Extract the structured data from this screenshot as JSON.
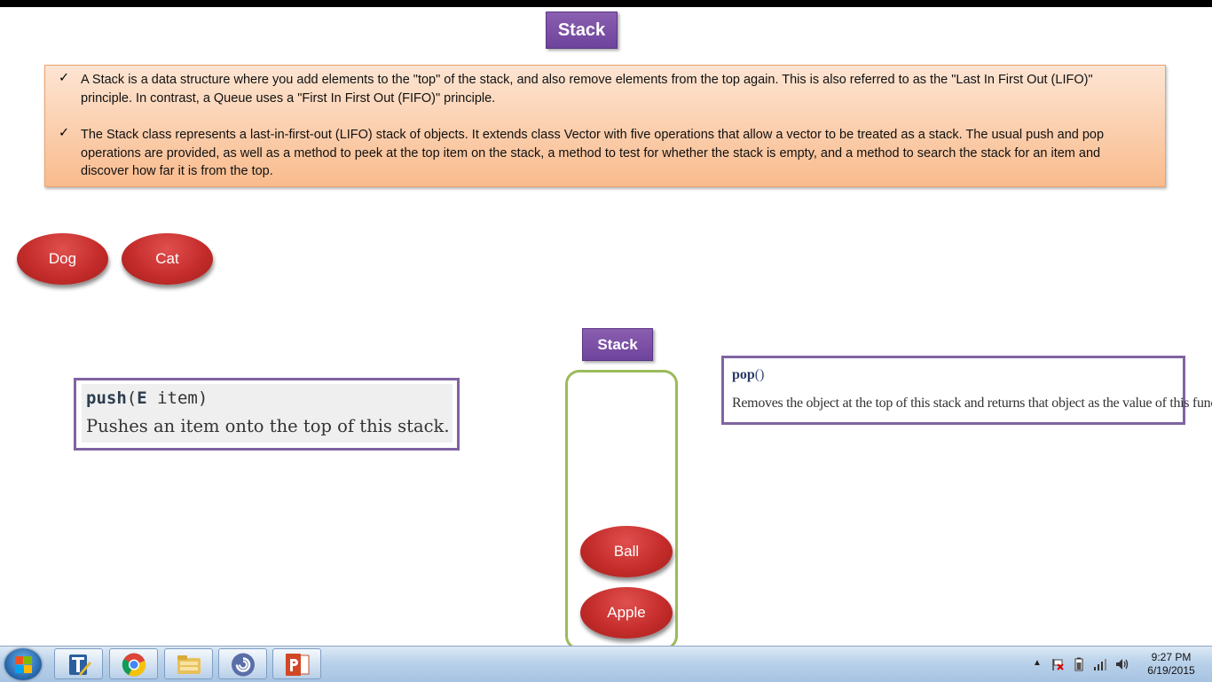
{
  "slide": {
    "title": "Stack",
    "bullets": [
      {
        "mark": "✓",
        "text": "A Stack is a data structure where you add elements to the \"top\" of the stack, and also remove elements from the top again. This is also referred to as the \"Last In First Out (LIFO)\" principle. In contrast, a Queue uses a \"First In First Out (FIFO)\" principle."
      },
      {
        "mark": "✓",
        "text": "The Stack class represents a last-in-first-out (LIFO) stack of objects. It extends class Vector with five operations that allow a vector to be treated as a stack. The usual push and pop operations are provided, as well as a method to peek at the top item on the stack, a method to test for whether the stack is empty, and a method to search the stack for an item and discover how far it is from the top."
      }
    ],
    "loose_items": [
      "Dog",
      "Cat"
    ],
    "stack_label": "Stack",
    "stack_items": [
      "Ball",
      "Apple"
    ],
    "push": {
      "name": "push",
      "params": "(E item)",
      "type": "E",
      "param_name": " item",
      "desc": "Pushes an item onto the top of this stack."
    },
    "pop": {
      "name": "pop",
      "parens": "()",
      "desc": "Removes the object at the top of this stack and returns that object as the value of this function."
    }
  },
  "taskbar": {
    "apps": [
      "text-editor-icon",
      "chrome-icon",
      "file-explorer-icon",
      "bittorrent-icon",
      "powerpoint-icon"
    ],
    "clock_time": "9:27 PM",
    "clock_date": "6/19/2015"
  }
}
